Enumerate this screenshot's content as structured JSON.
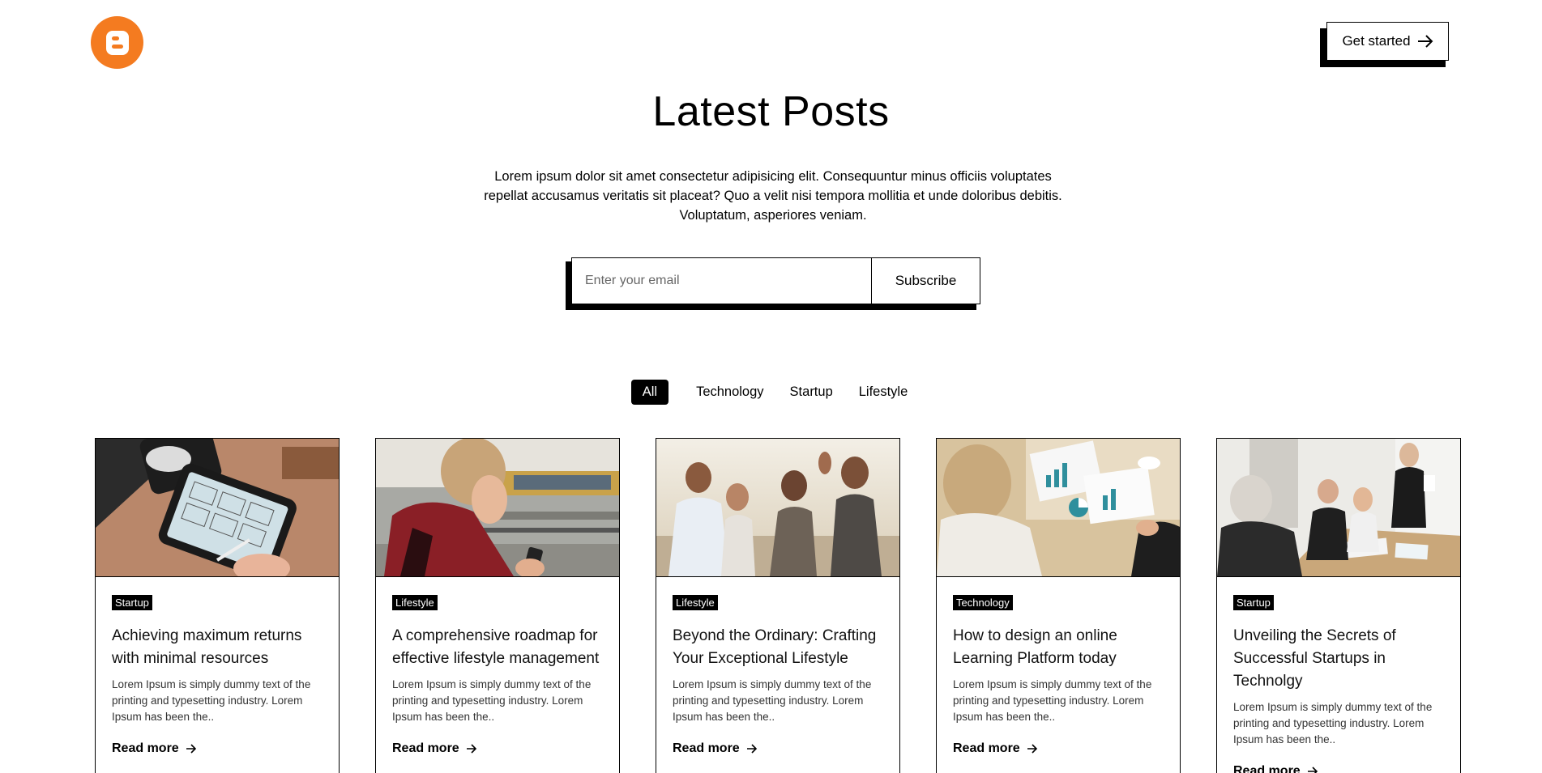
{
  "header": {
    "brand_color": "#f47b20",
    "cta_label": "Get started"
  },
  "hero": {
    "title": "Latest Posts",
    "subtitle": "Lorem ipsum dolor sit amet consectetur adipisicing elit. Consequuntur minus officiis voluptates repellat accusamus veritatis sit placeat? Quo a velit nisi tempora mollitia et unde doloribus debitis. Voluptatum, asperiores veniam."
  },
  "subscribe": {
    "email_placeholder": "Enter your email",
    "email_value": "",
    "button_label": "Subscribe"
  },
  "filters": [
    {
      "label": "All",
      "active": true
    },
    {
      "label": "Technology",
      "active": false
    },
    {
      "label": "Startup",
      "active": false
    },
    {
      "label": "Lifestyle",
      "active": false
    }
  ],
  "posts": [
    {
      "tag": "Startup",
      "title": "Achieving maximum returns with minimal resources",
      "excerpt": "Lorem Ipsum is simply dummy text of the printing and typesetting industry. Lorem Ipsum has been the..",
      "read_more": "Read more",
      "image": "tablet-wireframe-photo"
    },
    {
      "tag": "Lifestyle",
      "title": "A comprehensive roadmap for effective lifestyle management",
      "excerpt": "Lorem Ipsum is simply dummy text of the printing and typesetting industry. Lorem Ipsum has been the..",
      "read_more": "Read more",
      "image": "woman-phone-photo"
    },
    {
      "tag": "Lifestyle",
      "title": "Beyond the Ordinary: Crafting Your Exceptional Lifestyle",
      "excerpt": "Lorem Ipsum is simply dummy text of the printing and typesetting industry. Lorem Ipsum has been the..",
      "read_more": "Read more",
      "image": "friends-group-photo"
    },
    {
      "tag": "Technology",
      "title": "How to design an online Learning Platform today",
      "excerpt": "Lorem Ipsum is simply dummy text of the printing and typesetting industry. Lorem Ipsum has been the..",
      "read_more": "Read more",
      "image": "charts-meeting-photo"
    },
    {
      "tag": "Startup",
      "title": "Unveiling the Secrets of Successful Startups in Technolgy",
      "excerpt": "Lorem Ipsum is simply dummy text of the printing and typesetting industry. Lorem Ipsum has been the..",
      "read_more": "Read more",
      "image": "office-meeting-photo"
    }
  ]
}
